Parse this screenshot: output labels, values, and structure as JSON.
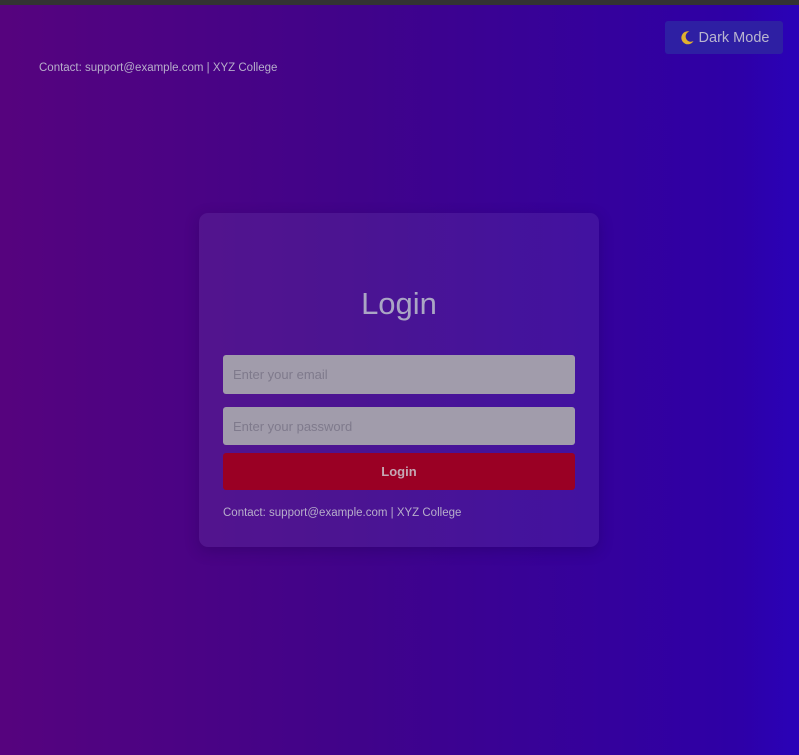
{
  "theme_toggle": {
    "icon": "moon-icon",
    "label": "Dark Mode"
  },
  "header": {
    "contact": "Contact: support@example.com | XYZ College"
  },
  "login_card": {
    "title": "Login",
    "email_placeholder": "Enter your email",
    "email_value": "",
    "password_placeholder": "Enter your password",
    "password_value": "",
    "submit_label": "Login",
    "contact": "Contact: support@example.com | XYZ College"
  },
  "colors": {
    "background_start": "#56037e",
    "background_end": "#2a02b8",
    "toggle_bg": "#2e1fa3",
    "login_button": "#9a0024",
    "input_bg": "#a19cab",
    "moon": "#e0b030"
  }
}
